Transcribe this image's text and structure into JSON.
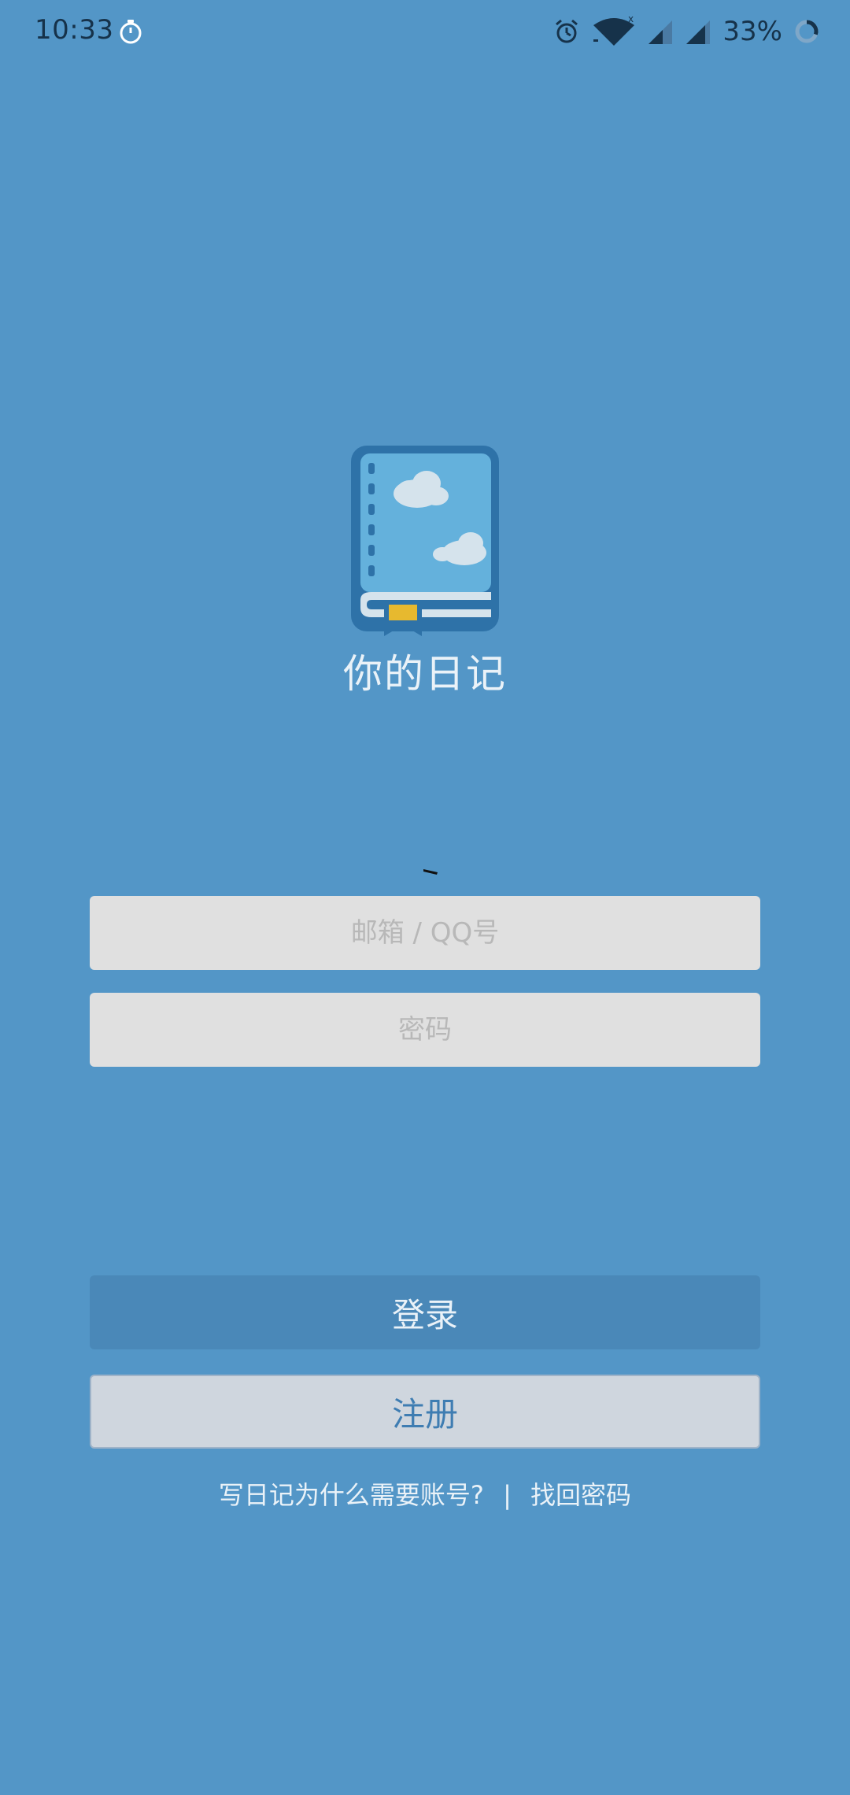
{
  "status_bar": {
    "time": "10:33",
    "battery": "33%",
    "icons": [
      "timer-icon",
      "alarm-icon",
      "wifi-icon",
      "signal-icon",
      "signal-icon",
      "battery-ring-icon"
    ]
  },
  "app": {
    "title": "你的日记",
    "logo_icon": "diary-book-icon"
  },
  "form": {
    "email_placeholder": "邮箱 / QQ号",
    "password_placeholder": "密码"
  },
  "buttons": {
    "login": "登录",
    "register": "注册"
  },
  "links": {
    "why_account": "写日记为什么需要账号?",
    "separator": "|",
    "recover_password": "找回密码"
  },
  "colors": {
    "background": "#5396C7",
    "login_button": "#4A88B8",
    "register_button": "#CFD6DE",
    "input_bg": "#E0E0E0",
    "bookmark": "#E7B92F"
  }
}
